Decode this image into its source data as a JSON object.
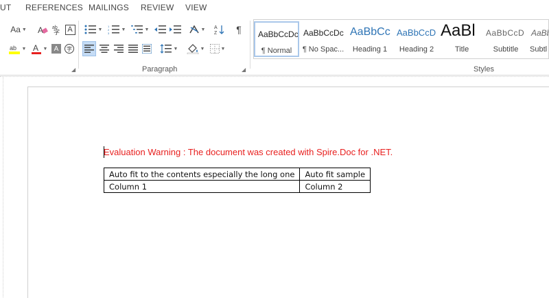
{
  "tabs": [
    "UT",
    "REFERENCES",
    "MAILINGS",
    "REVIEW",
    "VIEW"
  ],
  "ribbon": {
    "font_row1": [
      "Aa",
      "A"
    ],
    "font_row2": [
      "ab",
      "A",
      "A",
      "字"
    ],
    "paragraph_label": "Paragraph",
    "styles_label": "Styles",
    "pilcrow": "¶"
  },
  "styles": [
    {
      "preview": "AaBbCcDc",
      "name": "¶ Normal"
    },
    {
      "preview": "AaBbCcDc",
      "name": "¶ No Spac..."
    },
    {
      "preview": "AaBbCc",
      "name": "Heading 1"
    },
    {
      "preview": "AaBbCcD",
      "name": "Heading 2"
    },
    {
      "preview": "AaBl",
      "name": "Title"
    },
    {
      "preview": "AaBbCcD",
      "name": "Subtitle"
    },
    {
      "preview": "AaBbCcD",
      "name": "Subtl"
    }
  ],
  "document": {
    "warning": "Evaluation Warning : The document was created with Spire.Doc for .NET.",
    "table": [
      [
        "Auto fit to the contents especially the long one",
        "Auto fit sample"
      ],
      [
        "Column 1",
        "Column 2"
      ]
    ]
  },
  "colors": {
    "warning": "#e8201f",
    "heading_blue": "#2e74b5",
    "highlight_yellow": "#ffff00",
    "font_red": "#e8201f"
  }
}
